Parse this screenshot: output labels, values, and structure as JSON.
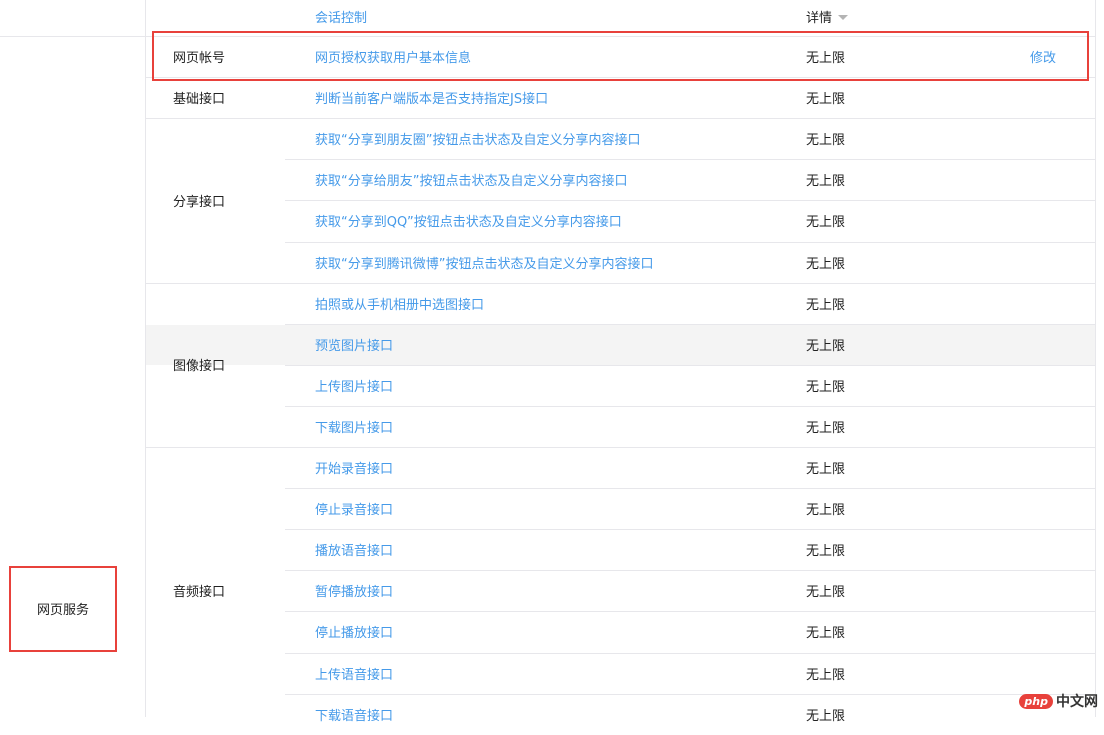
{
  "header": {
    "api": "会话控制",
    "detail": "详情"
  },
  "service": {
    "label": "网页服务"
  },
  "rows": [
    {
      "api": "网页授权获取用户基本信息",
      "limit": "无上限",
      "action": "修改"
    },
    {
      "api": "判断当前客户端版本是否支持指定JS接口",
      "limit": "无上限"
    },
    {
      "api": "获取“分享到朋友圈”按钮点击状态及自定义分享内容接口",
      "limit": "无上限"
    },
    {
      "api": "获取“分享给朋友”按钮点击状态及自定义分享内容接口",
      "limit": "无上限"
    },
    {
      "api": "获取“分享到QQ”按钮点击状态及自定义分享内容接口",
      "limit": "无上限"
    },
    {
      "api": "获取“分享到腾讯微博”按钮点击状态及自定义分享内容接口",
      "limit": "无上限"
    },
    {
      "api": "拍照或从手机相册中选图接口",
      "limit": "无上限"
    },
    {
      "api": "预览图片接口",
      "limit": "无上限"
    },
    {
      "api": "上传图片接口",
      "limit": "无上限"
    },
    {
      "api": "下载图片接口",
      "limit": "无上限"
    },
    {
      "api": "开始录音接口",
      "limit": "无上限"
    },
    {
      "api": "停止录音接口",
      "limit": "无上限"
    },
    {
      "api": "播放语音接口",
      "limit": "无上限"
    },
    {
      "api": "暂停播放接口",
      "limit": "无上限"
    },
    {
      "api": "停止播放接口",
      "limit": "无上限"
    },
    {
      "api": "上传语音接口",
      "limit": "无上限"
    },
    {
      "api": "下载语音接口",
      "limit": "无上限"
    }
  ],
  "groups": [
    {
      "label": "网页帐号"
    },
    {
      "label": "基础接口"
    },
    {
      "label": "分享接口"
    },
    {
      "label": "图像接口"
    },
    {
      "label": "音频接口"
    }
  ],
  "watermark": {
    "logo": "php",
    "text": "中文网"
  },
  "colors": {
    "link": "#459ae9",
    "highlight_border": "#e8413b",
    "grid": "#e7e7eb",
    "hover_row": "#f4f4f4"
  }
}
